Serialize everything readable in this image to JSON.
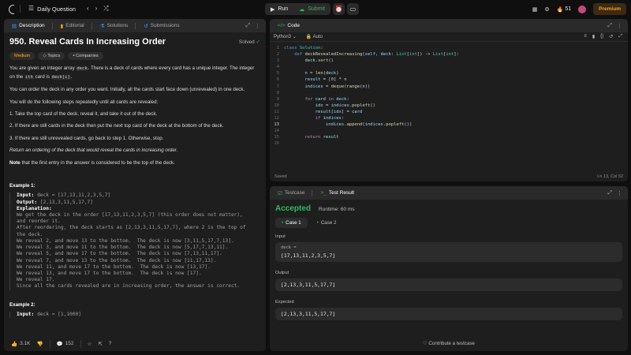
{
  "topbar": {
    "title": "Daily Question",
    "run_label": "Run",
    "submit_label": "Submit",
    "streak": "51",
    "premium_label": "Premium"
  },
  "desc_tabs": [
    "Description",
    "Editorial",
    "Solutions",
    "Submissions"
  ],
  "problem": {
    "title": "950. Reveal Cards In Increasing Order",
    "status": "Solved",
    "chips": [
      "Medium",
      "Topics",
      "Companies"
    ],
    "p1a": "You are given an integer array ",
    "p1code": "deck",
    "p1b": ". There is a deck of cards where every card has a unique integer. The integer on the ",
    "p1sup": "ith",
    "p1c": " card is ",
    "p1code2": "deck[i]",
    "p1d": ".",
    "p2": "You can order the deck in any order you want. Initially, all the cards start face down (unrevealed) in one deck.",
    "p3": "You will do the following steps repeatedly until all cards are revealed:",
    "step1": "1. Take the top card of the deck, reveal it, and take it out of the deck.",
    "step2": "2. If there are still cards in the deck then put the next top card of the deck at the bottom of the deck.",
    "step3": "3. If there are still unrevealed cards, go back to step 1. Otherwise, stop.",
    "p4": "Return an ordering of the deck that would reveal the cards in increasing order.",
    "note_label": "Note",
    "note_text": " that the first entry in the answer is considered to be the top of the deck.",
    "ex1_title": "Example 1:",
    "ex1_input_label": "Input:",
    "ex1_input": " deck = [17,13,11,2,3,5,7]",
    "ex1_output_label": "Output:",
    "ex1_output": " [2,13,3,11,5,17,7]",
    "ex1_expl_label": "Explanation:",
    "ex1_expl": "We get the deck in the order [17,13,11,2,3,5,7] (this order does not matter),\nand reorder it.\nAfter reordering, the deck starts as [2,13,3,11,5,17,7], where 2 is the top of\nthe deck.\nWe reveal 2, and move 13 to the bottom.  The deck is now [3,11,5,17,7,13].\nWe reveal 3, and move 11 to the bottom.  The deck is now [5,17,7,13,11].\nWe reveal 5, and move 17 to the bottom.  The deck is now [7,13,11,17].\nWe reveal 7, and move 13 to the bottom.  The deck is now [11,17,13].\nWe reveal 11, and move 17 to the bottom.  The deck is now [13,17].\nWe reveal 13, and move 17 to the bottom.  The deck is now [17].\nWe reveal 17.\nSince all the cards revealed are in increasing order, the answer is correct.",
    "ex2_title": "Example 2:",
    "ex2_input_label": "Input:",
    "ex2_input": " deck = [1,1000]"
  },
  "desc_footer": {
    "likes": "3.1K",
    "comments": "152"
  },
  "code_panel": {
    "tab": "Code",
    "language": "Python3",
    "mode": "Auto",
    "saved": "Saved",
    "cursor": "Ln 13, Col 52"
  },
  "result_panel": {
    "tabs": [
      "Testcase",
      "Test Result"
    ],
    "status": "Accepted",
    "runtime": "Runtime: 60 ms",
    "cases": [
      "Case 1",
      "Case 2"
    ],
    "input_label": "Input",
    "input_var": "deck =",
    "input_value": "[17,13,11,2,3,5,7]",
    "output_label": "Output",
    "output_value": "[2,13,3,11,5,17,7]",
    "expected_label": "Expected",
    "expected_value": "[2,13,3,11,5,17,7]",
    "contribute": "Contribute a testcase"
  },
  "colors": {
    "accent": "#ffa116",
    "success": "#2cbb5d",
    "panel": "#1e1e1e"
  }
}
